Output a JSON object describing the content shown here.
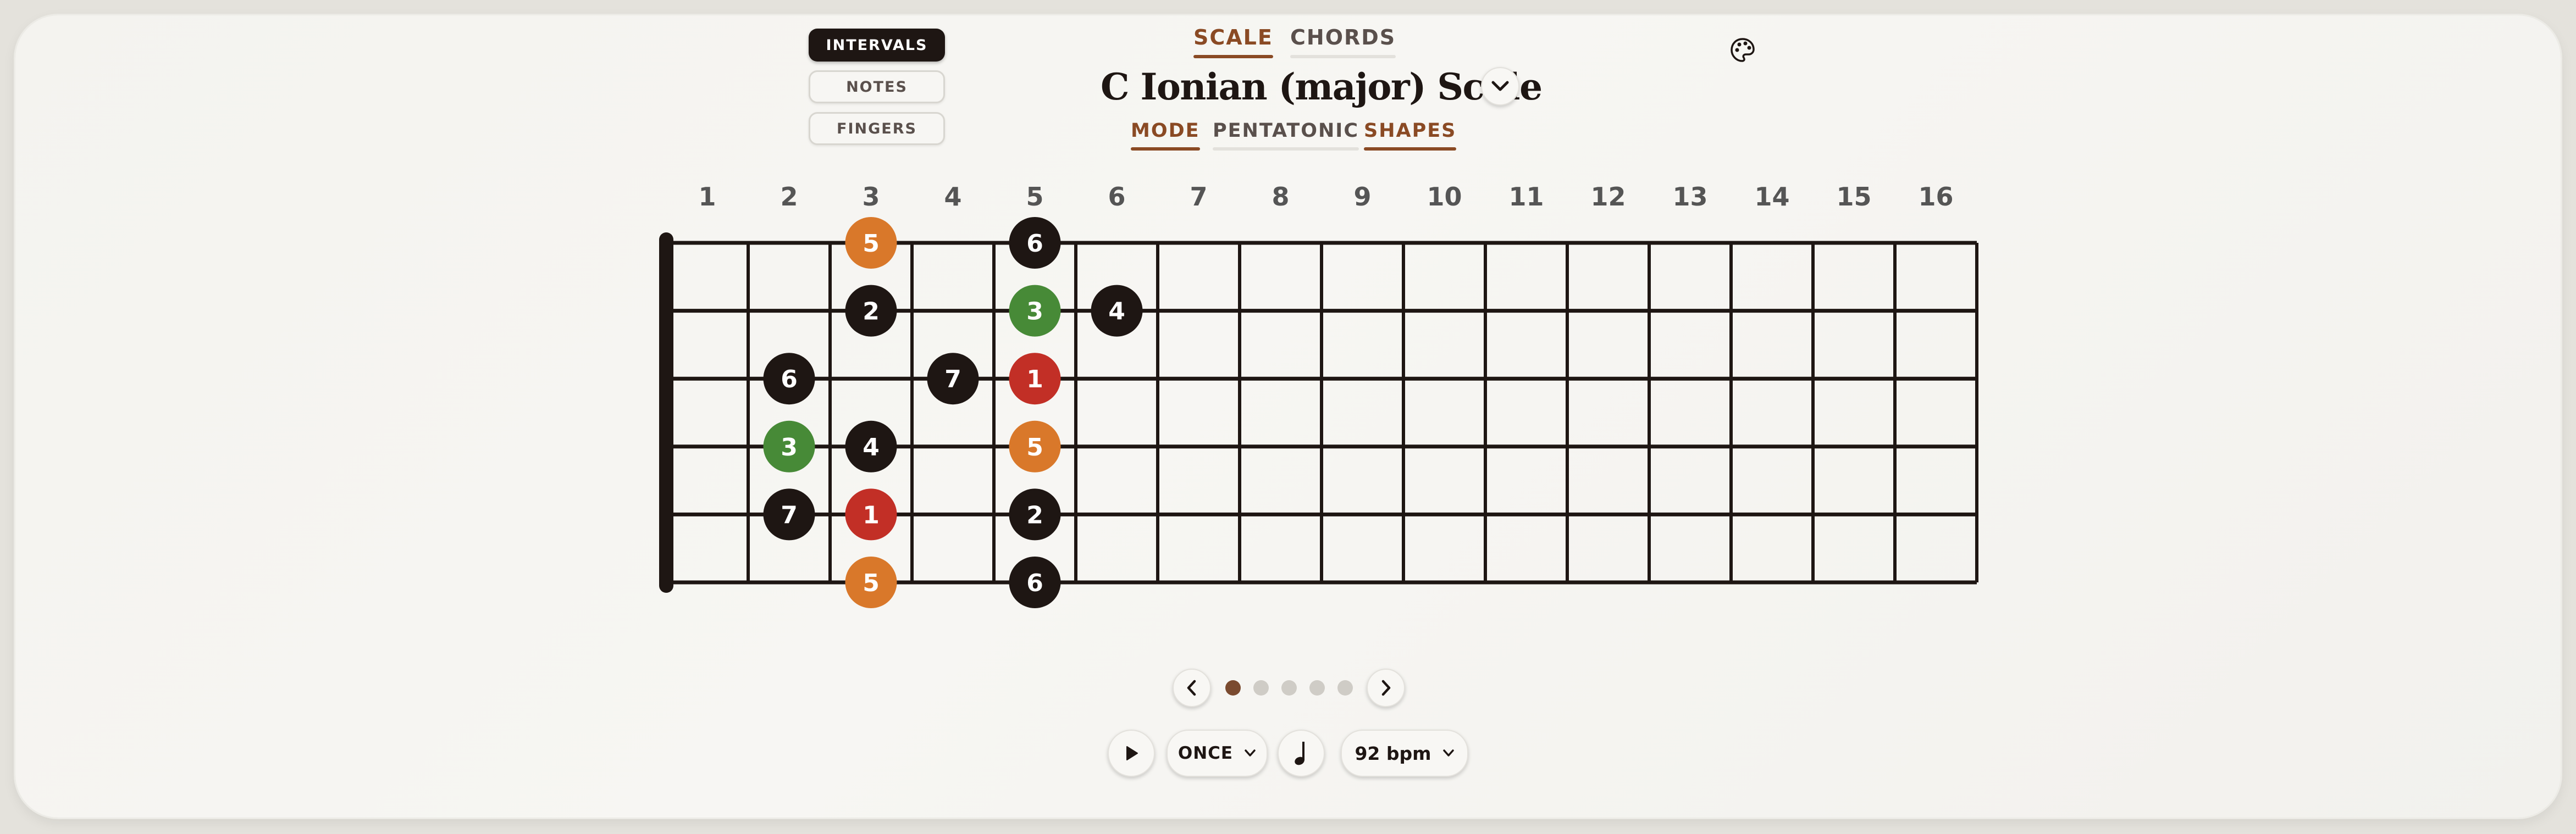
{
  "display_modes": [
    {
      "label": "INTERVALS",
      "active": true
    },
    {
      "label": "NOTES",
      "active": false
    },
    {
      "label": "FINGERS",
      "active": false
    }
  ],
  "top_tabs": [
    {
      "label": "SCALE",
      "active": true
    },
    {
      "label": "CHORDS",
      "active": false
    }
  ],
  "scale_title": "C Ionian (major) Scale",
  "sub_tabs": [
    {
      "label": "MODE",
      "active": true
    },
    {
      "label": "PENTATONIC",
      "active": false
    },
    {
      "label": "SHAPES",
      "active": true
    }
  ],
  "icons": {
    "palette": "palette-icon",
    "title_dropdown": "chevron-down-icon",
    "prev": "chevron-left-icon",
    "next": "chevron-right-icon",
    "play": "play-icon",
    "metronome": "quarter-note-icon"
  },
  "fretboard": {
    "fret_numbers": [
      "1",
      "2",
      "3",
      "4",
      "5",
      "6",
      "7",
      "8",
      "9",
      "10",
      "11",
      "12",
      "13",
      "14",
      "15",
      "16"
    ],
    "strings": 6,
    "notes": [
      {
        "string": 1,
        "fret": 3,
        "label": "5",
        "role": "fifth"
      },
      {
        "string": 1,
        "fret": 5,
        "label": "6",
        "role": "other"
      },
      {
        "string": 2,
        "fret": 3,
        "label": "2",
        "role": "other"
      },
      {
        "string": 2,
        "fret": 5,
        "label": "3",
        "role": "third"
      },
      {
        "string": 2,
        "fret": 6,
        "label": "4",
        "role": "other"
      },
      {
        "string": 3,
        "fret": 2,
        "label": "6",
        "role": "other"
      },
      {
        "string": 3,
        "fret": 4,
        "label": "7",
        "role": "other"
      },
      {
        "string": 3,
        "fret": 5,
        "label": "1",
        "role": "root"
      },
      {
        "string": 4,
        "fret": 2,
        "label": "3",
        "role": "third"
      },
      {
        "string": 4,
        "fret": 3,
        "label": "4",
        "role": "other"
      },
      {
        "string": 4,
        "fret": 5,
        "label": "5",
        "role": "fifth"
      },
      {
        "string": 5,
        "fret": 2,
        "label": "7",
        "role": "other"
      },
      {
        "string": 5,
        "fret": 3,
        "label": "1",
        "role": "root"
      },
      {
        "string": 5,
        "fret": 5,
        "label": "2",
        "role": "other"
      },
      {
        "string": 6,
        "fret": 3,
        "label": "5",
        "role": "fifth"
      },
      {
        "string": 6,
        "fret": 5,
        "label": "6",
        "role": "other"
      }
    ]
  },
  "pagination": {
    "count": 5,
    "active_index": 0
  },
  "playback": {
    "repeat_label": "ONCE",
    "tempo_label": "92 bpm"
  },
  "colors": {
    "root": "#c22f26",
    "third": "#478a37",
    "fifth": "#d9782a",
    "other": "#1e1613",
    "dark": "#1e1613",
    "accent_underline": "#8a4a24",
    "dot_active": "#7a4a2f",
    "dot_inactive": "#cfccc6"
  }
}
